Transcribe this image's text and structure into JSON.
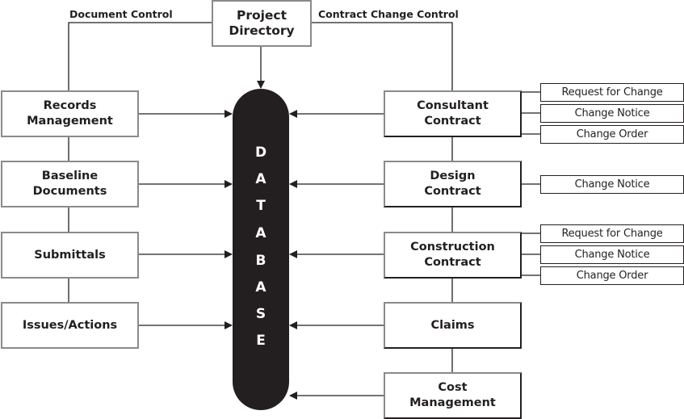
{
  "diagram": {
    "header_labels": {
      "left": "Document Control",
      "right": "Contract Change Control"
    },
    "top_node": {
      "id": "project-directory",
      "label": "Project\nDirectory"
    },
    "database": {
      "label": "DATABASE",
      "letters": [
        "D",
        "A",
        "T",
        "A",
        "B",
        "A",
        "S",
        "E"
      ]
    },
    "left_nodes": [
      {
        "id": "records-management",
        "label": "Records\nManagement"
      },
      {
        "id": "baseline-documents",
        "label": "Baseline\nDocuments"
      },
      {
        "id": "submittals",
        "label": "Submittals"
      },
      {
        "id": "issues-actions",
        "label": "Issues/Actions"
      }
    ],
    "right_nodes": [
      {
        "id": "consultant-contract",
        "label": "Consultant\nContract",
        "children": [
          "Request for Change",
          "Change Notice",
          "Change Order"
        ]
      },
      {
        "id": "design-contract",
        "label": "Design\nContract",
        "children": [
          "Change Notice"
        ]
      },
      {
        "id": "construction-contract",
        "label": "Construction\nContract",
        "children": [
          "Request for Change",
          "Change Notice",
          "Change Order"
        ]
      },
      {
        "id": "claims",
        "label": "Claims",
        "children": []
      },
      {
        "id": "cost-management",
        "label": "Cost\nManagement",
        "children": []
      }
    ],
    "edges": [
      {
        "from": "project-directory",
        "to": "database"
      },
      {
        "from": "records-management",
        "to": "database"
      },
      {
        "from": "baseline-documents",
        "to": "database"
      },
      {
        "from": "submittals",
        "to": "database"
      },
      {
        "from": "issues-actions",
        "to": "database"
      },
      {
        "from": "consultant-contract",
        "to": "database"
      },
      {
        "from": "design-contract",
        "to": "database"
      },
      {
        "from": "construction-contract",
        "to": "database"
      },
      {
        "from": "claims",
        "to": "database"
      },
      {
        "from": "cost-management",
        "to": "database"
      }
    ]
  }
}
